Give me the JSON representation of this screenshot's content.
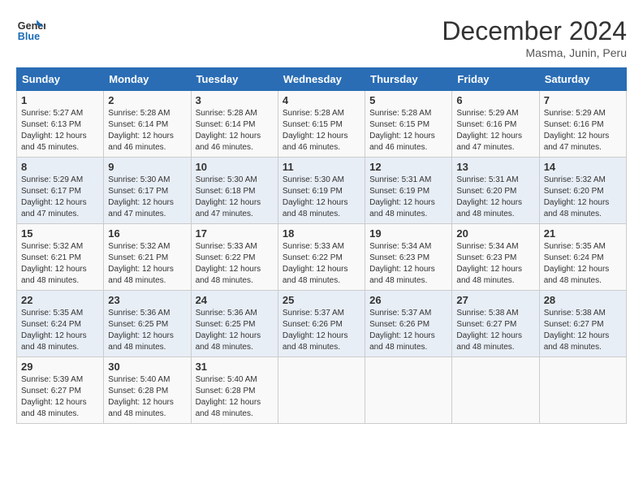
{
  "logo": {
    "line1": "General",
    "line2": "Blue"
  },
  "title": "December 2024",
  "subtitle": "Masma, Junin, Peru",
  "days_header": [
    "Sunday",
    "Monday",
    "Tuesday",
    "Wednesday",
    "Thursday",
    "Friday",
    "Saturday"
  ],
  "weeks": [
    [
      {
        "day": "1",
        "sunrise": "5:27 AM",
        "sunset": "6:13 PM",
        "daylight": "12 hours and 45 minutes."
      },
      {
        "day": "2",
        "sunrise": "5:28 AM",
        "sunset": "6:14 PM",
        "daylight": "12 hours and 46 minutes."
      },
      {
        "day": "3",
        "sunrise": "5:28 AM",
        "sunset": "6:14 PM",
        "daylight": "12 hours and 46 minutes."
      },
      {
        "day": "4",
        "sunrise": "5:28 AM",
        "sunset": "6:15 PM",
        "daylight": "12 hours and 46 minutes."
      },
      {
        "day": "5",
        "sunrise": "5:28 AM",
        "sunset": "6:15 PM",
        "daylight": "12 hours and 46 minutes."
      },
      {
        "day": "6",
        "sunrise": "5:29 AM",
        "sunset": "6:16 PM",
        "daylight": "12 hours and 47 minutes."
      },
      {
        "day": "7",
        "sunrise": "5:29 AM",
        "sunset": "6:16 PM",
        "daylight": "12 hours and 47 minutes."
      }
    ],
    [
      {
        "day": "8",
        "sunrise": "5:29 AM",
        "sunset": "6:17 PM",
        "daylight": "12 hours and 47 minutes."
      },
      {
        "day": "9",
        "sunrise": "5:30 AM",
        "sunset": "6:17 PM",
        "daylight": "12 hours and 47 minutes."
      },
      {
        "day": "10",
        "sunrise": "5:30 AM",
        "sunset": "6:18 PM",
        "daylight": "12 hours and 47 minutes."
      },
      {
        "day": "11",
        "sunrise": "5:30 AM",
        "sunset": "6:19 PM",
        "daylight": "12 hours and 48 minutes."
      },
      {
        "day": "12",
        "sunrise": "5:31 AM",
        "sunset": "6:19 PM",
        "daylight": "12 hours and 48 minutes."
      },
      {
        "day": "13",
        "sunrise": "5:31 AM",
        "sunset": "6:20 PM",
        "daylight": "12 hours and 48 minutes."
      },
      {
        "day": "14",
        "sunrise": "5:32 AM",
        "sunset": "6:20 PM",
        "daylight": "12 hours and 48 minutes."
      }
    ],
    [
      {
        "day": "15",
        "sunrise": "5:32 AM",
        "sunset": "6:21 PM",
        "daylight": "12 hours and 48 minutes."
      },
      {
        "day": "16",
        "sunrise": "5:32 AM",
        "sunset": "6:21 PM",
        "daylight": "12 hours and 48 minutes."
      },
      {
        "day": "17",
        "sunrise": "5:33 AM",
        "sunset": "6:22 PM",
        "daylight": "12 hours and 48 minutes."
      },
      {
        "day": "18",
        "sunrise": "5:33 AM",
        "sunset": "6:22 PM",
        "daylight": "12 hours and 48 minutes."
      },
      {
        "day": "19",
        "sunrise": "5:34 AM",
        "sunset": "6:23 PM",
        "daylight": "12 hours and 48 minutes."
      },
      {
        "day": "20",
        "sunrise": "5:34 AM",
        "sunset": "6:23 PM",
        "daylight": "12 hours and 48 minutes."
      },
      {
        "day": "21",
        "sunrise": "5:35 AM",
        "sunset": "6:24 PM",
        "daylight": "12 hours and 48 minutes."
      }
    ],
    [
      {
        "day": "22",
        "sunrise": "5:35 AM",
        "sunset": "6:24 PM",
        "daylight": "12 hours and 48 minutes."
      },
      {
        "day": "23",
        "sunrise": "5:36 AM",
        "sunset": "6:25 PM",
        "daylight": "12 hours and 48 minutes."
      },
      {
        "day": "24",
        "sunrise": "5:36 AM",
        "sunset": "6:25 PM",
        "daylight": "12 hours and 48 minutes."
      },
      {
        "day": "25",
        "sunrise": "5:37 AM",
        "sunset": "6:26 PM",
        "daylight": "12 hours and 48 minutes."
      },
      {
        "day": "26",
        "sunrise": "5:37 AM",
        "sunset": "6:26 PM",
        "daylight": "12 hours and 48 minutes."
      },
      {
        "day": "27",
        "sunrise": "5:38 AM",
        "sunset": "6:27 PM",
        "daylight": "12 hours and 48 minutes."
      },
      {
        "day": "28",
        "sunrise": "5:38 AM",
        "sunset": "6:27 PM",
        "daylight": "12 hours and 48 minutes."
      }
    ],
    [
      {
        "day": "29",
        "sunrise": "5:39 AM",
        "sunset": "6:27 PM",
        "daylight": "12 hours and 48 minutes."
      },
      {
        "day": "30",
        "sunrise": "5:40 AM",
        "sunset": "6:28 PM",
        "daylight": "12 hours and 48 minutes."
      },
      {
        "day": "31",
        "sunrise": "5:40 AM",
        "sunset": "6:28 PM",
        "daylight": "12 hours and 48 minutes."
      },
      null,
      null,
      null,
      null
    ]
  ]
}
